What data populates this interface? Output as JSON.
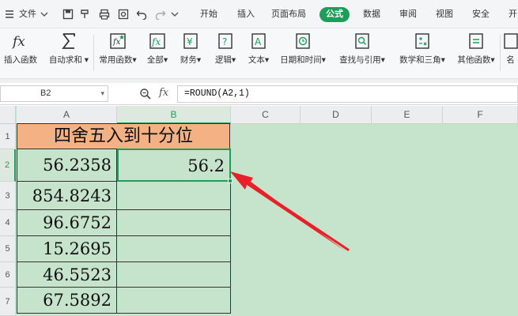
{
  "menu": {
    "file_label": "文件",
    "tabs": [
      "开始",
      "插入",
      "页面布局",
      "公式",
      "数据",
      "审阅",
      "视图",
      "安全",
      "开"
    ],
    "active_tab": "公式"
  },
  "ribbon": {
    "buttons": [
      {
        "label": "插入函数",
        "icon": "fx-icon"
      },
      {
        "label": "自动求和",
        "icon": "sigma-icon"
      },
      {
        "label": "常用函数",
        "icon": "star-fx-icon"
      },
      {
        "label": "全部",
        "icon": "fx-box-icon"
      },
      {
        "label": "财务",
        "icon": "finance-icon"
      },
      {
        "label": "逻辑",
        "icon": "question-icon"
      },
      {
        "label": "文本",
        "icon": "text-a-icon"
      },
      {
        "label": "日期和时间",
        "icon": "clock-icon"
      },
      {
        "label": "查找与引用",
        "icon": "search-doc-icon"
      },
      {
        "label": "数学和三角",
        "icon": "math-icon"
      },
      {
        "label": "其他函数",
        "icon": "more-func-icon"
      },
      {
        "label": "名",
        "icon": "name-icon"
      }
    ],
    "accent": "#1e9e5a"
  },
  "formula_bar": {
    "name_box": "B2",
    "fx_label": "fx",
    "formula": "=ROUND(A2,1)"
  },
  "grid": {
    "columns": [
      "A",
      "B",
      "C",
      "D",
      "E",
      "F"
    ],
    "selected_column": "B",
    "rows": [
      "1",
      "2",
      "3",
      "4",
      "5",
      "6",
      "7"
    ],
    "selected_row": "2",
    "title": "四舍五入到十分位",
    "values_a": [
      "56.2358",
      "854.8243",
      "96.6752",
      "15.2695",
      "46.5523",
      "67.5892"
    ],
    "value_b2": "56.2",
    "sheet_color": "#c6e4cb",
    "title_fill": "#f4b183",
    "arrow_color": "#e8202a"
  }
}
